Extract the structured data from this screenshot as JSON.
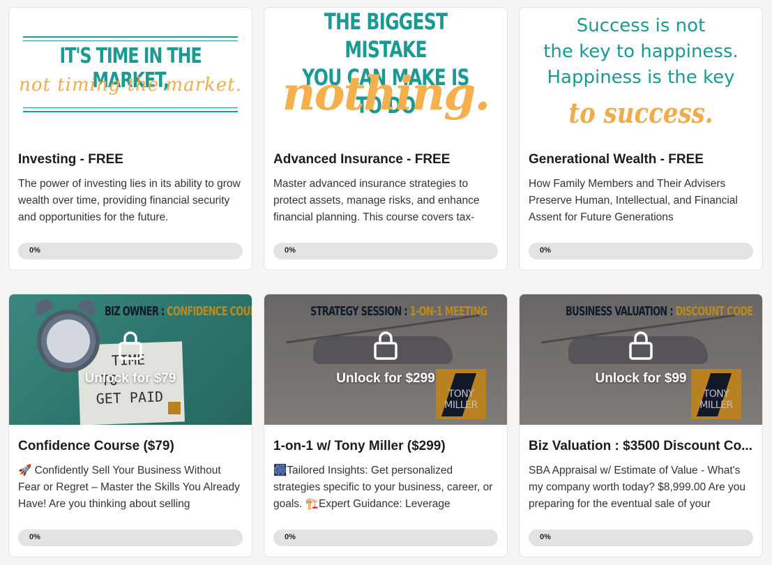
{
  "courses": [
    {
      "title": "Investing - FREE",
      "description": "The power of investing lies in its ability to grow wealth over time, providing financial security and opportunities for the future.",
      "progress_label": "0%",
      "progress": 0,
      "image_text": [
        "IT'S TIME IN THE MARKET,",
        "not timing the market."
      ]
    },
    {
      "title": "Advanced Insurance - FREE",
      "description": "Master advanced insurance strategies to protect assets, manage risks, and enhance financial planning. This course covers tax-",
      "progress_label": "0%",
      "progress": 0,
      "image_text": [
        "THE BIGGEST MISTAKE",
        "YOU CAN MAKE IS TO DO",
        "nothing."
      ]
    },
    {
      "title": "Generational Wealth - FREE",
      "description": "How Family Members and Their Advisers Preserve Human, Intellectual, and Financial Assent for Future Generations",
      "progress_label": "0%",
      "progress": 0,
      "image_text": [
        "Success is not",
        "the key to happiness.",
        "Happiness is the key",
        "to success."
      ]
    },
    {
      "title": "Confidence Course ($79)",
      "description": "🚀 Confidently Sell Your Business Without Fear or Regret – Master the Skills You Already Have! Are you thinking about selling",
      "progress_label": "0%",
      "progress": 0,
      "unlock_label": "Unlock for $79",
      "banner": [
        "BIZ OWNER : ",
        "CONFIDENCE COURSE"
      ],
      "image_text": [
        "TIME",
        "TO",
        "GET PAID"
      ]
    },
    {
      "title": "1-on-1 w/ Tony Miller ($299)",
      "description": "🎆Tailored Insights: Get personalized strategies specific to your business, career, or goals. 🏗️Expert Guidance: Leverage",
      "progress_label": "0%",
      "progress": 0,
      "unlock_label": "Unlock for $299",
      "banner": [
        "STRATEGY SESSION : ",
        "1-ON-1 MEETING"
      ],
      "logo_text": [
        "TONY",
        "MILLER"
      ]
    },
    {
      "title": "Biz Valuation : $3500 Discount Co...",
      "description": "SBA Appraisal w/ Estimate of Value - What's my company worth today? $8,999.00 Are you preparing for the eventual sale of your",
      "progress_label": "0%",
      "progress": 0,
      "unlock_label": "Unlock for $99",
      "banner": [
        "BUSINESS VALUATION : ",
        "DISCOUNT CODE"
      ],
      "logo_text": [
        "TONY",
        "MILLER"
      ]
    }
  ],
  "colors": {
    "teal": "#1a9a93",
    "orange": "#f0ac4a",
    "gold": "#c4921f",
    "progress_track": "#e3e3e3"
  },
  "icons": {
    "lock": "lock-icon"
  }
}
